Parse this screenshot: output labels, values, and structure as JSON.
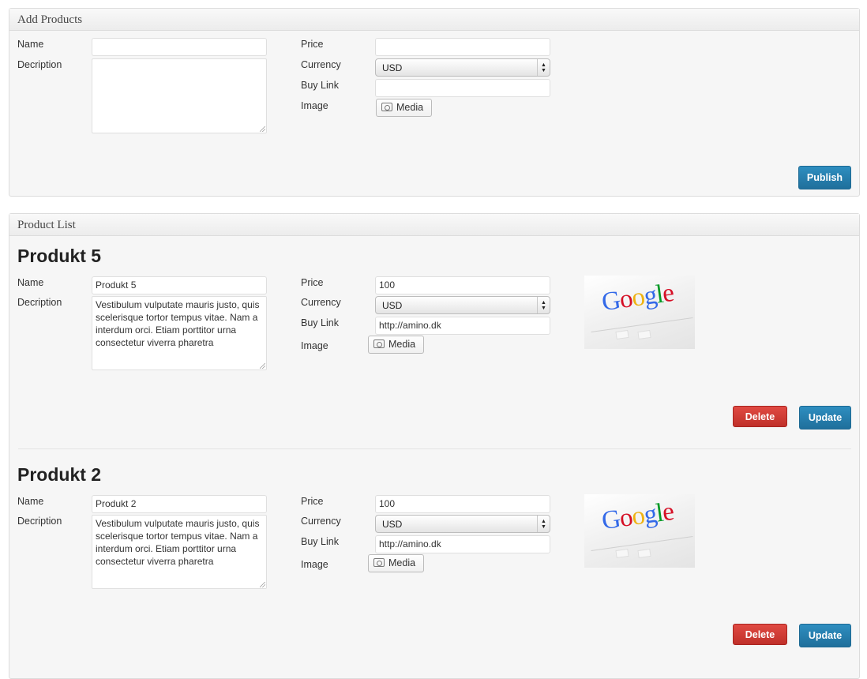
{
  "add_panel": {
    "title": "Add Products",
    "labels": {
      "name": "Name",
      "description": "Decription",
      "price": "Price",
      "currency": "Currency",
      "buy_link": "Buy Link",
      "image": "Image"
    },
    "name_value": "",
    "description_value": "",
    "price_value": "",
    "currency_value": "USD",
    "buy_link_value": "",
    "media_label": "Media",
    "publish_label": "Publish"
  },
  "list_panel": {
    "title": "Product List",
    "labels": {
      "name": "Name",
      "description": "Decription",
      "price": "Price",
      "currency": "Currency",
      "buy_link": "Buy Link",
      "image": "Image"
    },
    "media_label": "Media",
    "delete_label": "Delete",
    "update_label": "Update",
    "products": [
      {
        "heading": "Produkt 5",
        "name": "Produkt 5",
        "description": "Vestibulum vulputate mauris justo, quis scelerisque tortor tempus vitae. Nam a interdum orci. Etiam porttitor urna consectetur viverra pharetra",
        "price": "100",
        "currency": "USD",
        "buy_link": "http://amino.dk",
        "image_logo": "Google"
      },
      {
        "heading": "Produkt 2",
        "name": "Produkt 2",
        "description": "Vestibulum vulputate mauris justo, quis scelerisque tortor tempus vitae. Nam a interdum orci. Etiam porttitor urna consectetur viverra pharetra",
        "price": "100",
        "currency": "USD",
        "buy_link": "http://amino.dk",
        "image_logo": "Google"
      }
    ]
  },
  "icons": {
    "media": "media-camera-icon",
    "select_arrows": "select-arrows-icon"
  }
}
